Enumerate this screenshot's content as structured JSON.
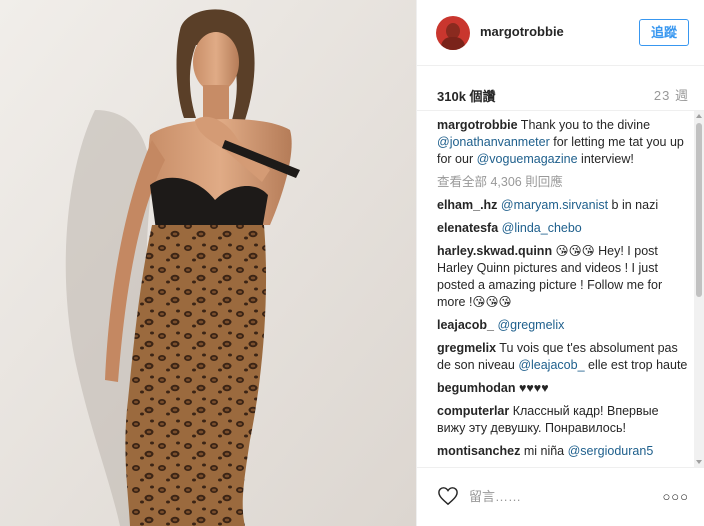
{
  "post": {
    "username": "margotrobbie",
    "follow_label": "追蹤",
    "likes": "310k 個讚",
    "time": "23 週",
    "caption": {
      "author": "margotrobbie",
      "text_1": " Thank you to the divine ",
      "mention_1": "@jonathanvanmeter",
      "text_2": " for letting me tat you up for our ",
      "mention_2": "@voguemagazine",
      "text_3": " interview!"
    },
    "view_all": "查看全部 4,306 則回應",
    "comments": [
      {
        "author": "elham_.hz",
        "mention": "@maryam.sirvanist",
        "text": " b in nazi"
      },
      {
        "author": "elenatesfa",
        "mention": "@linda_chebo",
        "text": ""
      },
      {
        "author": "harley.skwad.quinn",
        "mention": "",
        "text": " 😘😘😘 Hey! I post Harley Quinn pictures and videos ! I just posted a amazing picture ! Follow me for more !😘😘😘"
      },
      {
        "author": "leajacob_",
        "mention": "@gregmelix",
        "text": ""
      },
      {
        "author": "gregmelix",
        "mention": "",
        "text": " Tu vois que t'es absolument pas de son niveau ",
        "mention_after": "@leajacob_",
        "text_after": " elle est trop haute"
      },
      {
        "author": "begumhodan",
        "mention": "",
        "text": " ♥♥♥♥"
      },
      {
        "author": "computerlar",
        "mention": "",
        "text": " Классный кадр! Впервые вижу эту девушку. Понравилось!"
      },
      {
        "author": "montisanchez",
        "mention": "",
        "text": " mi niña ",
        "mention_after": "@sergioduran5",
        "text_after": ""
      }
    ],
    "comment_placeholder": "留言……",
    "more_label": "○○○"
  },
  "icons": {
    "like": "heart-icon",
    "avatar": "avatar-icon",
    "more": "more-options-icon"
  },
  "colors": {
    "follow_blue": "#3897f0",
    "mention": "#1e5f8c",
    "muted": "#999999"
  }
}
